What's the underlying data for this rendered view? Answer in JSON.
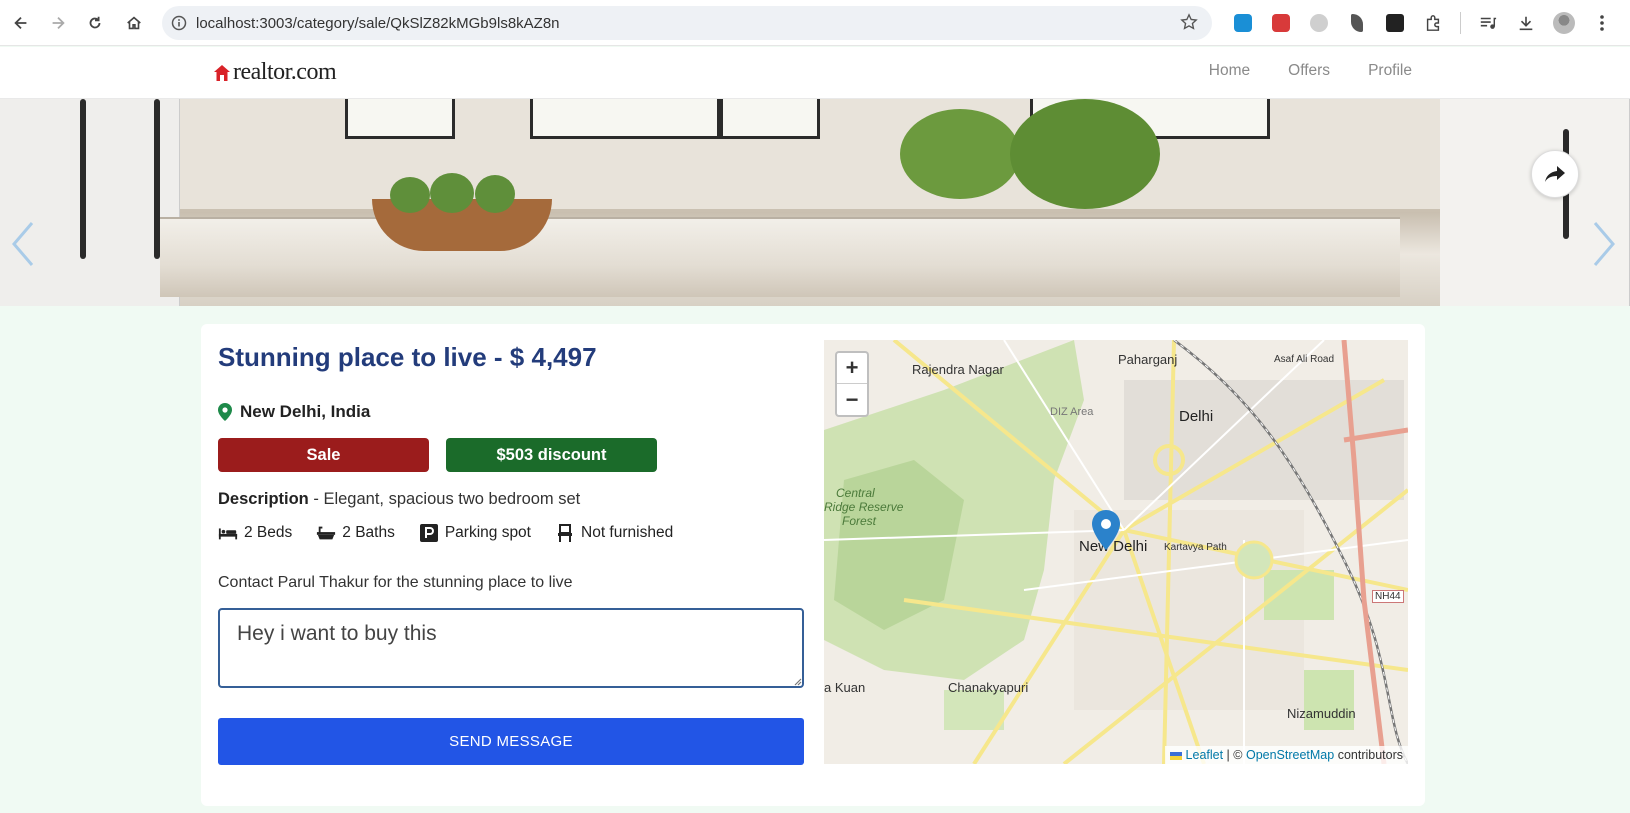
{
  "browser": {
    "url": "localhost:3003/category/sale/QkSlZ82kMGb9ls8kAZ8n"
  },
  "header": {
    "logo_text": "realtor.com",
    "nav": [
      "Home",
      "Offers",
      "Profile"
    ]
  },
  "listing": {
    "title": "Stunning place to live - $ 4,497",
    "location": "New Delhi, India",
    "type_badge": "Sale",
    "discount_badge": "$503 discount",
    "description_label": "Description",
    "description_text": " - Elegant, spacious two bedroom set",
    "features": {
      "beds": "2 Beds",
      "baths": "2 Baths",
      "parking": "Parking spot",
      "furnished": "Not furnished"
    },
    "contact_text": "Contact Parul Thakur for the stunning place to live",
    "message_value": "Hey i want to buy this ",
    "send_label": "SEND MESSAGE"
  },
  "map": {
    "zoom_in": "+",
    "zoom_out": "−",
    "labels": {
      "rajendra_nagar": "Rajendra Nagar",
      "paharganj": "Paharganj",
      "delhi": "Delhi",
      "diz_area": "DIZ Area",
      "central_ridge": "Central",
      "ridge_reserve": "Ridge Reserve",
      "forest": "Forest",
      "new_delhi": "New Delhi",
      "kartavya_path": "Kartavya Path",
      "nh44": "NH44",
      "chanakyapuri": "Chanakyapuri",
      "nizamuddin": "Nizamuddin",
      "kuan": "a Kuan",
      "asaf_ali": "Asaf Ali Road"
    },
    "attribution_leaflet": "Leaflet",
    "attribution_sep": " | © ",
    "attribution_osm": "OpenStreetMap",
    "attribution_tail": " contributors"
  },
  "colors": {
    "title": "#233c7b",
    "sale": "#9b1c1c",
    "discount": "#1b6b2a",
    "send": "#2255e6",
    "page_bg": "#f0faf3"
  }
}
